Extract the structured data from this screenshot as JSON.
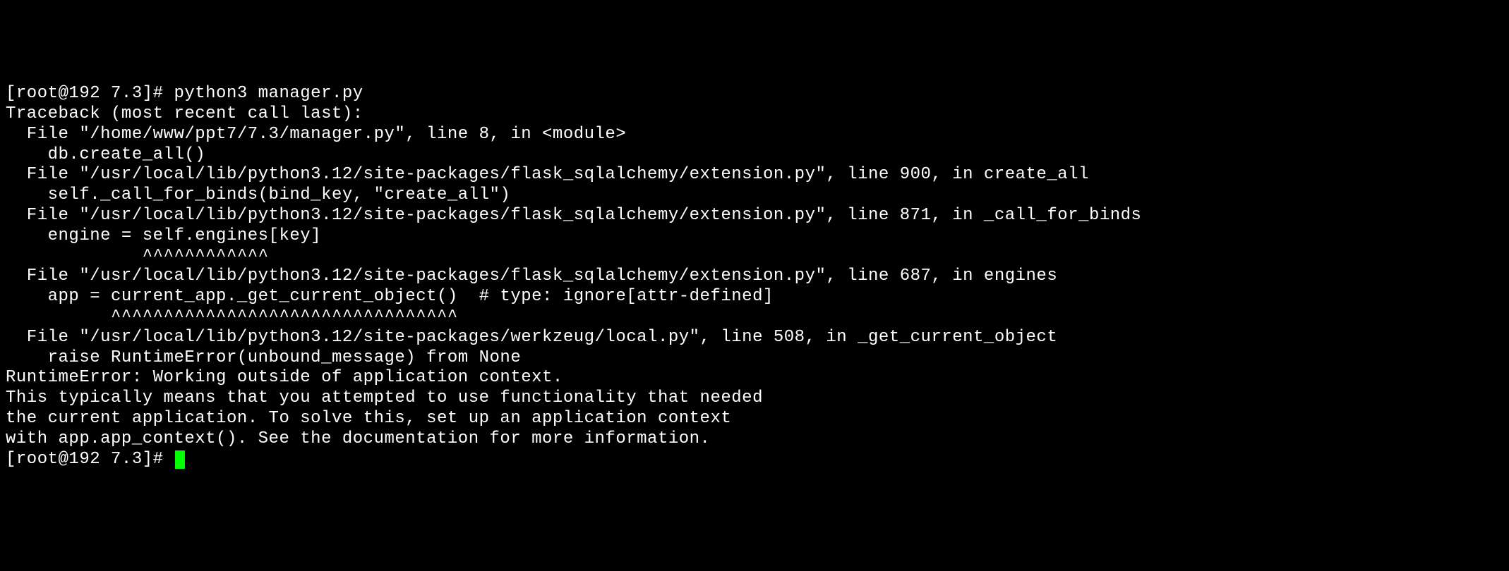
{
  "terminal": {
    "lines": [
      "[root@192 7.3]# python3 manager.py",
      "Traceback (most recent call last):",
      "  File \"/home/www/ppt7/7.3/manager.py\", line 8, in <module>",
      "    db.create_all()",
      "  File \"/usr/local/lib/python3.12/site-packages/flask_sqlalchemy/extension.py\", line 900, in create_all",
      "    self._call_for_binds(bind_key, \"create_all\")",
      "  File \"/usr/local/lib/python3.12/site-packages/flask_sqlalchemy/extension.py\", line 871, in _call_for_binds",
      "    engine = self.engines[key]",
      "             ^^^^^^^^^^^^",
      "  File \"/usr/local/lib/python3.12/site-packages/flask_sqlalchemy/extension.py\", line 687, in engines",
      "    app = current_app._get_current_object()  # type: ignore[attr-defined]",
      "          ^^^^^^^^^^^^^^^^^^^^^^^^^^^^^^^^^",
      "  File \"/usr/local/lib/python3.12/site-packages/werkzeug/local.py\", line 508, in _get_current_object",
      "    raise RuntimeError(unbound_message) from None",
      "RuntimeError: Working outside of application context.",
      "",
      "This typically means that you attempted to use functionality that needed",
      "the current application. To solve this, set up an application context",
      "with app.app_context(). See the documentation for more information."
    ],
    "prompt": "[root@192 7.3]# "
  }
}
